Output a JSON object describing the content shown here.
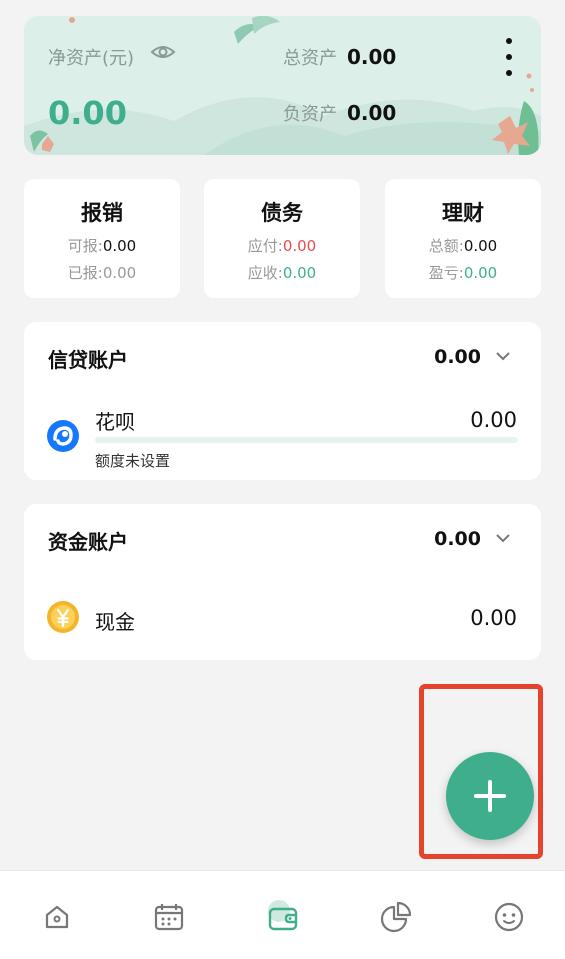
{
  "summary": {
    "net_assets_label": "净资产(元)",
    "net_assets_value": "0.00",
    "total_assets_label": "总资产",
    "total_assets_value": "0.00",
    "liabilities_label": "负资产",
    "liabilities_value": "0.00"
  },
  "stats": [
    {
      "title": "报销",
      "row1_label": "可报:",
      "row1_value": "0.00",
      "row2_label": "已报:",
      "row2_value": "0.00"
    },
    {
      "title": "债务",
      "row1_label": "应付:",
      "row1_value": "0.00",
      "row2_label": "应收:",
      "row2_value": "0.00"
    },
    {
      "title": "理财",
      "row1_label": "总额:",
      "row1_value": "0.00",
      "row2_label": "盈亏:",
      "row2_value": "0.00"
    }
  ],
  "credit": {
    "title": "信贷账户",
    "total": "0.00",
    "account": {
      "name": "花呗",
      "value": "0.00",
      "subtitle": "额度未设置",
      "usage_fraction": 0
    }
  },
  "cash": {
    "title": "资金账户",
    "total": "0.00",
    "account": {
      "name": "现金",
      "value": "0.00"
    }
  },
  "icons": {
    "eye": "eye-icon",
    "more": "more-vertical-icon",
    "expand": "chevron-down-icon",
    "huabei": "huabei-logo-icon",
    "cash": "yen-coin-icon",
    "add": "plus-icon",
    "nav": [
      "home-icon",
      "calendar-icon",
      "wallet-icon",
      "pie-chart-icon",
      "smiley-icon"
    ]
  },
  "colors": {
    "accent": "#3fae8c",
    "negative": "#e84c4c",
    "highlight": "#e6432e"
  }
}
